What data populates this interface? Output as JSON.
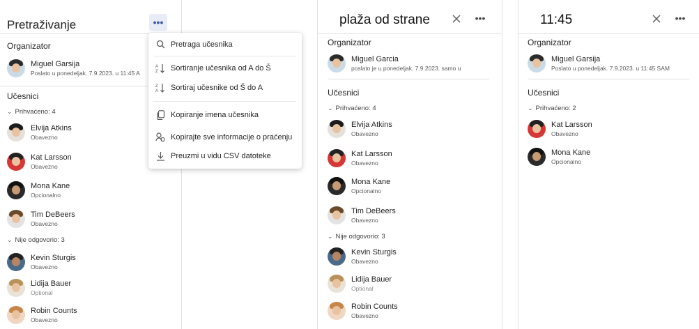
{
  "colors": {
    "accent": "#3c5aa6",
    "text": "#242424",
    "subtext": "#5c5c5c",
    "divider": "#e1e1e1"
  },
  "panel1": {
    "title": "Pretraživanje",
    "more_icon": "more-horizontal-icon",
    "organizer_label": "Organizator",
    "organizer": {
      "name": "Miguel Garsija",
      "sub": "Poslato u ponedeljak. 7.9.2023. u 11:45 A"
    },
    "attendees_label": "Učesnici",
    "group_accepted": "Prihvaćeno: 4",
    "accepted": [
      {
        "name": "Elvija Atkins",
        "sub": "Obavezno"
      },
      {
        "name": "Kat Larsson",
        "sub": "Obavezno"
      },
      {
        "name": "Mona Kane",
        "sub": "Opcionalno"
      },
      {
        "name": "Tim DeBeers",
        "sub": "Obavezno"
      }
    ],
    "group_noreply": "Nije odgovorio: 3",
    "noreply": [
      {
        "name": "Kevin Sturgis",
        "sub": "Obavezno"
      },
      {
        "name": "Lidija Bauer",
        "sub": "Optional"
      },
      {
        "name": "Robin Counts",
        "sub": "Obavezno"
      }
    ]
  },
  "menu": {
    "items": [
      {
        "label": "Pretraga učesnika",
        "icon": "search-icon"
      },
      {
        "label": "Sortiranje učesnika od A do Š",
        "icon": "sort-ascending-icon"
      },
      {
        "label": "Sortiraj učesnike od Š do A",
        "icon": "sort-descending-icon"
      },
      {
        "label": "Kopiranje imena učesnika",
        "icon": "copy-icon"
      },
      {
        "label": "Kopirajte sve informacije o praćenju",
        "icon": "copy-tracking-icon"
      },
      {
        "label": "Preuzmi u vidu CSV datoteke",
        "icon": "download-icon"
      }
    ]
  },
  "panel2": {
    "title": "plaža od strane",
    "organizer_label": "Organizator",
    "organizer": {
      "name": "Miguel Garcia",
      "sub": "poslato je u ponedeljak. 7.9.2023. samo u"
    },
    "attendees_label": "Učesnici",
    "group_accepted": "Prihvaćeno: 4",
    "accepted": [
      {
        "name": "Elvija Atkins",
        "sub": "Obavezno"
      },
      {
        "name": "Kat Larsson",
        "sub": "Obavezno"
      },
      {
        "name": "Mona Kane",
        "sub": "Opcionalno"
      },
      {
        "name": "Tim DeBeers",
        "sub": "Obavezno"
      }
    ],
    "group_noreply": "Nije odgovorio: 3",
    "noreply": [
      {
        "name": "Kevin Sturgis",
        "sub": "Obavezno"
      },
      {
        "name": "Lidija Bauer",
        "sub": "Optional"
      },
      {
        "name": "Robin Counts",
        "sub": "Obavezno"
      }
    ]
  },
  "panel3": {
    "title": "11:45",
    "organizer_label": "Organizator",
    "organizer": {
      "name": "Miguel Garsija",
      "sub": "Poslato u ponedeljak. 7.9.2023. u 11:45 SAM"
    },
    "attendees_label": "Učesnici",
    "group_accepted": "Prihvaćeno: 2",
    "accepted": [
      {
        "name": "Kat Larsson",
        "sub": "Obavezno"
      },
      {
        "name": "Mona Kane",
        "sub": "Opcionalno"
      }
    ]
  }
}
